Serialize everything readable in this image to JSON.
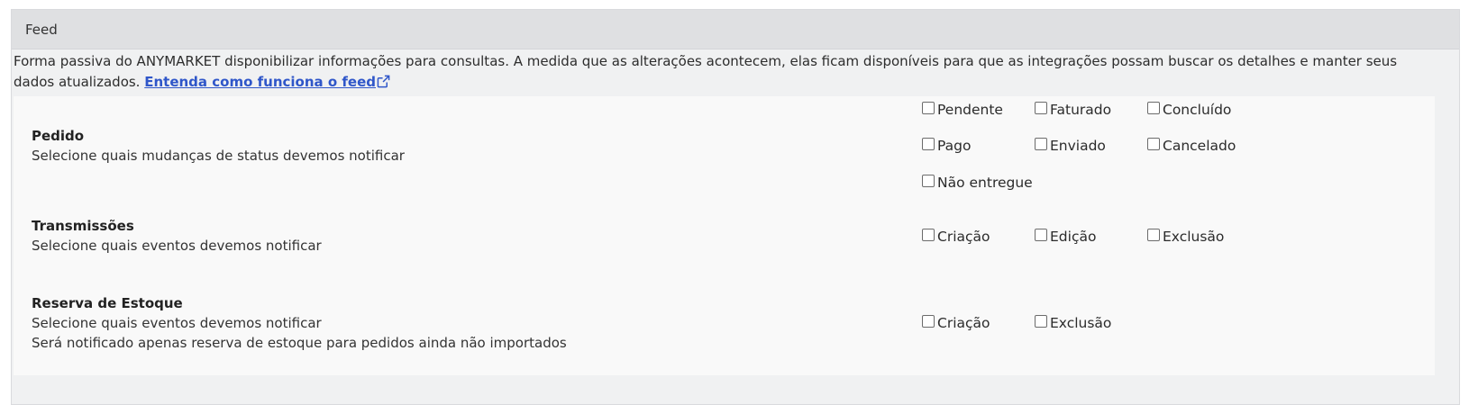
{
  "panel": {
    "title": "Feed",
    "description": "Forma passiva do ANYMARKET disponibilizar informações para consultas. A medida que as alterações acontecem, elas ficam disponíveis para que as integrações possam buscar os detalhes e manter seus dados atualizados.",
    "link_label": "Entenda como funciona o feed",
    "link_icon": "external-link-icon"
  },
  "sections": {
    "pedido": {
      "title": "Pedido",
      "subtitle": "Selecione quais mudanças de status devemos notificar",
      "options": [
        "Pendente",
        "Faturado",
        "Concluído",
        "Pago",
        "Enviado",
        "Cancelado",
        "Não entregue"
      ]
    },
    "transmissoes": {
      "title": "Transmissões",
      "subtitle": "Selecione quais eventos devemos notificar",
      "options": [
        "Criação",
        "Edição",
        "Exclusão"
      ]
    },
    "reserva": {
      "title": "Reserva de Estoque",
      "subtitle": "Selecione quais eventos devemos notificar",
      "note": "Será notificado apenas reserva de estoque para pedidos ainda não importados",
      "options": [
        "Criação",
        "Exclusão"
      ]
    }
  },
  "colors": {
    "header_bg": "#dfe0e2",
    "content_bg": "#f9f9f9",
    "link": "#2f56c9"
  }
}
